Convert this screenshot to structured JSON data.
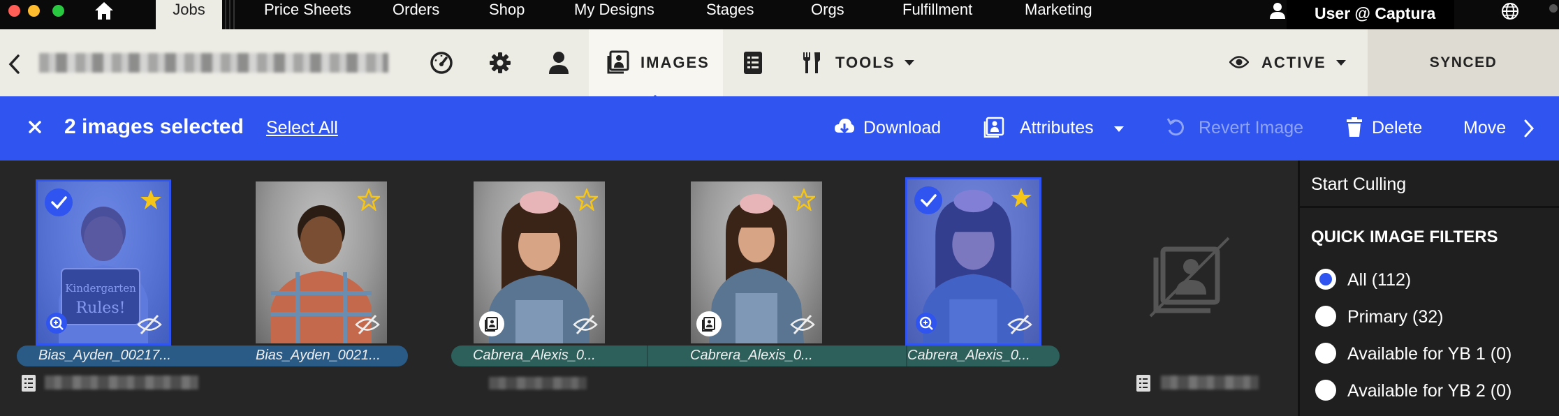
{
  "topnav": {
    "active_tab": "Jobs",
    "items": [
      "Price Sheets",
      "Orders",
      "Shop",
      "My Designs",
      "Stages",
      "Orgs",
      "Fulfillment",
      "Marketing"
    ],
    "user": "User @ Captura"
  },
  "toolbar": {
    "images_label": "IMAGES",
    "tools_label": "TOOLS",
    "status_label": "ACTIVE",
    "synced_label": "SYNCED"
  },
  "selection": {
    "count_label": "2 images selected",
    "select_all": "Select All",
    "download": "Download",
    "attributes": "Attributes",
    "revert": "Revert Image",
    "delete": "Delete",
    "move": "Move"
  },
  "images": [
    {
      "filename": "Bias_Ayden_00217...",
      "selected": true,
      "starred": true
    },
    {
      "filename": "Bias_Ayden_0021...",
      "selected": false,
      "starred": false
    },
    {
      "filename": "Cabrera_Alexis_0...",
      "selected": false,
      "starred": false
    },
    {
      "filename": "Cabrera_Alexis_0...",
      "selected": false,
      "starred": false
    },
    {
      "filename": "Cabrera_Alexis_0...",
      "selected": true,
      "starred": true
    }
  ],
  "panel": {
    "start_culling": "Start Culling",
    "filters_title": "QUICK IMAGE FILTERS",
    "filters": [
      {
        "label": "All (112)",
        "checked": true
      },
      {
        "label": "Primary (32)",
        "checked": false
      },
      {
        "label": "Available for YB 1 (0)",
        "checked": false
      },
      {
        "label": "Available for YB 2 (0)",
        "checked": false
      }
    ]
  },
  "colors": {
    "accent": "#2f54f0",
    "star": "#f5c518",
    "toolbar_bg": "#ecebe4"
  }
}
